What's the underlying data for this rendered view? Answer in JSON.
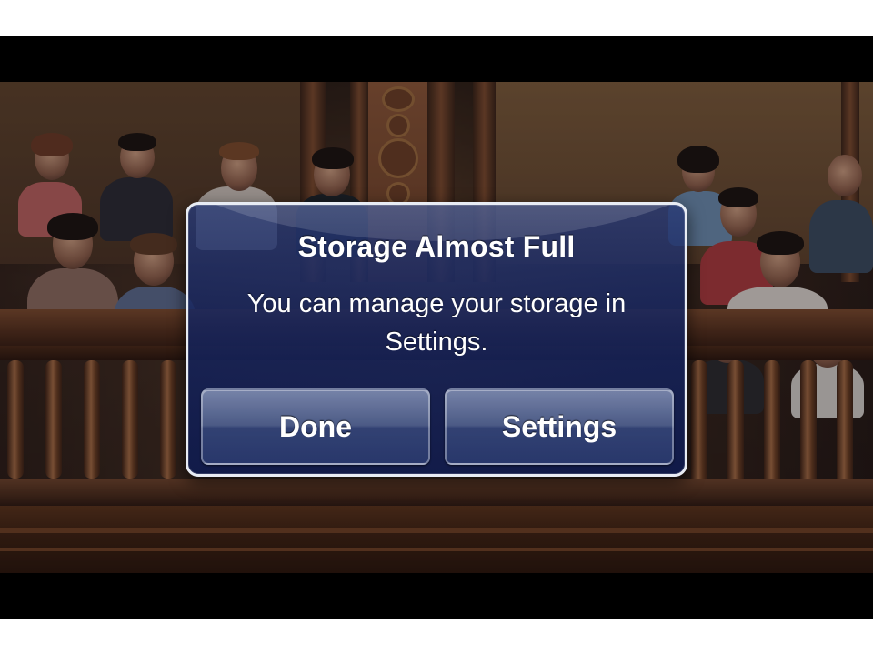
{
  "alert": {
    "title": "Storage Almost Full",
    "message": "You can manage your storage in Settings.",
    "buttons": [
      {
        "label": "Done"
      },
      {
        "label": "Settings"
      }
    ]
  },
  "colors": {
    "alert_background": "#16245c",
    "alert_border": "#e8ecf4",
    "text": "#ffffff",
    "letterbox": "#000000"
  }
}
